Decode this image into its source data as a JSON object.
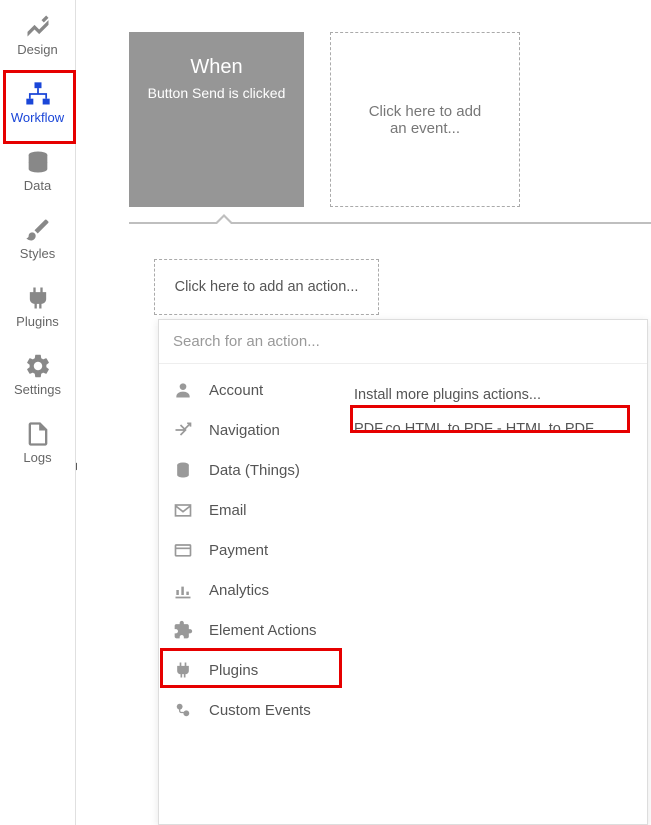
{
  "sidebar": {
    "items": [
      {
        "label": "Design"
      },
      {
        "label": "Workflow"
      },
      {
        "label": "Data"
      },
      {
        "label": "Styles"
      },
      {
        "label": "Plugins"
      },
      {
        "label": "Settings"
      },
      {
        "label": "Logs"
      }
    ]
  },
  "event": {
    "title": "When",
    "subtitle": "Button Send is clicked"
  },
  "add_event_label": "Click here to add an event...",
  "add_action_label": "Click here to add an action...",
  "search_placeholder": "Search for an action...",
  "categories": [
    {
      "label": "Account"
    },
    {
      "label": "Navigation"
    },
    {
      "label": "Data (Things)"
    },
    {
      "label": "Email"
    },
    {
      "label": "Payment"
    },
    {
      "label": "Analytics"
    },
    {
      "label": "Element Actions"
    },
    {
      "label": "Plugins"
    },
    {
      "label": "Custom Events"
    }
  ],
  "results": {
    "install_label": "Install more plugins actions...",
    "items": [
      {
        "label": "PDF.co HTML to PDF - HTML to PDF"
      }
    ]
  }
}
